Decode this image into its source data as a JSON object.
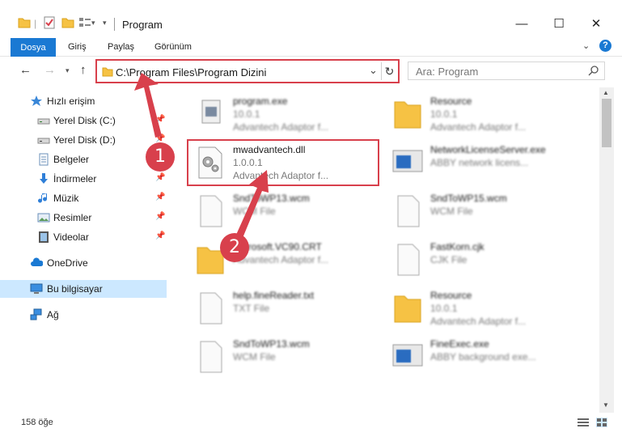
{
  "window": {
    "title": "Program",
    "minimize": "—",
    "maximize": "☐",
    "close": "✕"
  },
  "ribbon": {
    "tabs": [
      "Dosya",
      "Giriş",
      "Paylaş",
      "Görünüm"
    ],
    "help": "?"
  },
  "address": {
    "path": "C:\\Program Files\\Program Dizini"
  },
  "search": {
    "placeholder": "Ara: Program"
  },
  "sidebar": {
    "items": [
      {
        "label": "Hızlı erişim",
        "icon": "star-icon",
        "pinned": false
      },
      {
        "label": "Yerel Disk (C:)",
        "icon": "drive-icon",
        "pinned": true
      },
      {
        "label": "Yerel Disk (D:)",
        "icon": "drive-icon",
        "pinned": true
      },
      {
        "label": "Belgeler",
        "icon": "documents-icon",
        "pinned": true
      },
      {
        "label": "İndirmeler",
        "icon": "download-icon",
        "pinned": true
      },
      {
        "label": "Müzik",
        "icon": "music-icon",
        "pinned": true
      },
      {
        "label": "Resimler",
        "icon": "pictures-icon",
        "pinned": true
      },
      {
        "label": "Videolar",
        "icon": "videos-icon",
        "pinned": true
      },
      {
        "label": "OneDrive",
        "icon": "cloud-icon",
        "pinned": false
      },
      {
        "label": "Bu bilgisayar",
        "icon": "computer-icon",
        "pinned": false
      },
      {
        "label": "Ağ",
        "icon": "network-icon",
        "pinned": false
      }
    ]
  },
  "files": {
    "left": [
      {
        "name": "program.exe",
        "line1": "10.0.1",
        "line2": "Advantech Adaptor f...",
        "icon": "exe-icon"
      },
      {
        "name": "mwadvantech.dll",
        "line1": "1.0.0.1",
        "line2": "Advantech Adaptor f...",
        "icon": "dll-gear-icon"
      },
      {
        "name": "SndToWP13.wcm",
        "line1": "WCM File",
        "line2": "",
        "icon": "blank-file-icon"
      },
      {
        "name": "Microsoft.VC90.CRT",
        "line1": "Advantech Adaptor f...",
        "line2": "",
        "icon": "folder-icon"
      },
      {
        "name": "help.fineReader.txt",
        "line1": "TXT File",
        "line2": "",
        "icon": "blank-file-icon"
      },
      {
        "name": "SndToWP13.wcm",
        "line1": "WCM File",
        "line2": "",
        "icon": "blank-file-icon"
      }
    ],
    "right": [
      {
        "name": "Resource",
        "line1": "10.0.1",
        "line2": "Advantech Adaptor f...",
        "icon": "folder-icon"
      },
      {
        "name": "NetworkLicenseServer.exe",
        "line1": "ABBY network licens...",
        "line2": "",
        "icon": "window-exe-icon"
      },
      {
        "name": "SndToWP15.wcm",
        "line1": "WCM File",
        "line2": "",
        "icon": "blank-file-icon"
      },
      {
        "name": "FastKorn.cjk",
        "line1": "CJK File",
        "line2": "",
        "icon": "blank-file-icon"
      },
      {
        "name": "Resource",
        "line1": "10.0.1",
        "line2": "Advantech Adaptor f...",
        "icon": "folder-icon"
      },
      {
        "name": "FineExec.exe",
        "line1": "ABBY background exe...",
        "line2": "",
        "icon": "window-exe-icon"
      }
    ]
  },
  "status": {
    "count": "158 öğe"
  },
  "annotations": [
    "1",
    "2"
  ],
  "colors": {
    "accent": "#1a79d3",
    "highlight": "#d8404c",
    "selected": "#cce8ff"
  }
}
